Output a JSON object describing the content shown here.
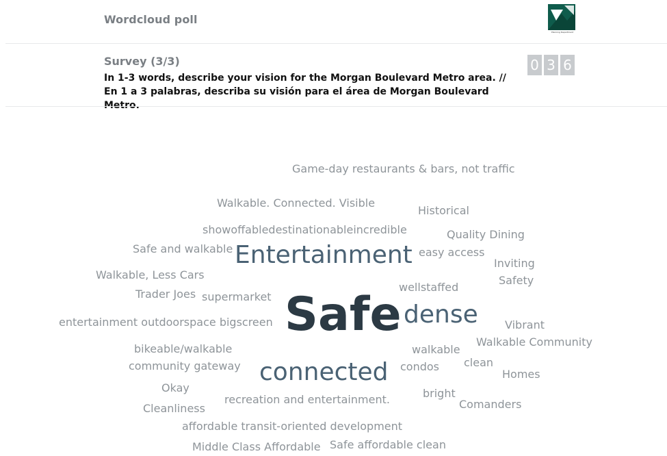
{
  "header": {
    "title": "Wordcloud poll",
    "logo": {
      "name": "planning-department-logo",
      "caption": "Planning Department"
    }
  },
  "survey": {
    "label": "Survey (3/3)",
    "question": "In 1-3 words, describe your vision for the Morgan Boulevard Metro area. // En 1 a 3 palabras, describa su visión para el área de Morgan Boulevard Metro.",
    "response_count_digits": [
      "0",
      "3",
      "6"
    ]
  },
  "colors": {
    "header_text": "#7a7f84",
    "question_text": "#111111",
    "counter_bg": "#c8cbce",
    "word_small": "#8e9499",
    "word_large": "#4a6274",
    "word_top": "#2c3a44",
    "logo_green": "#0f5c4c"
  },
  "wordcloud": {
    "words": [
      {
        "text": "Game-day restaurants & bars, not traffic",
        "weight": 1
      },
      {
        "text": "Walkable. Connected. Visible",
        "weight": 1
      },
      {
        "text": "Historical",
        "weight": 1
      },
      {
        "text": "showoffabledestinationableincredible",
        "weight": 1
      },
      {
        "text": "Quality Dining",
        "weight": 1
      },
      {
        "text": "Safe and walkable",
        "weight": 1
      },
      {
        "text": "Entertainment",
        "weight": 2
      },
      {
        "text": "easy access",
        "weight": 1
      },
      {
        "text": "Inviting",
        "weight": 1
      },
      {
        "text": "Walkable, Less Cars",
        "weight": 1
      },
      {
        "text": "Safety",
        "weight": 1
      },
      {
        "text": "wellstaffed",
        "weight": 1
      },
      {
        "text": "Trader Joes",
        "weight": 1
      },
      {
        "text": "supermarket",
        "weight": 1
      },
      {
        "text": "Safe",
        "weight": 3
      },
      {
        "text": "dense",
        "weight": 2
      },
      {
        "text": "entertainment outdoorspace bigscreen",
        "weight": 1
      },
      {
        "text": "Vibrant",
        "weight": 1
      },
      {
        "text": "Walkable Community",
        "weight": 1
      },
      {
        "text": "bikeable/walkable",
        "weight": 1
      },
      {
        "text": "walkable",
        "weight": 1
      },
      {
        "text": "community gateway",
        "weight": 1
      },
      {
        "text": "condos",
        "weight": 1
      },
      {
        "text": "clean",
        "weight": 1
      },
      {
        "text": "connected",
        "weight": 2
      },
      {
        "text": "Homes",
        "weight": 1
      },
      {
        "text": "Okay",
        "weight": 1
      },
      {
        "text": "bright",
        "weight": 1
      },
      {
        "text": "recreation and entertainment.",
        "weight": 1
      },
      {
        "text": "Comanders",
        "weight": 1
      },
      {
        "text": "Cleanliness",
        "weight": 1
      },
      {
        "text": "affordable transit-oriented development",
        "weight": 1
      },
      {
        "text": "Middle Class Affordable",
        "weight": 1
      },
      {
        "text": "Safe affordable clean",
        "weight": 1
      }
    ]
  }
}
